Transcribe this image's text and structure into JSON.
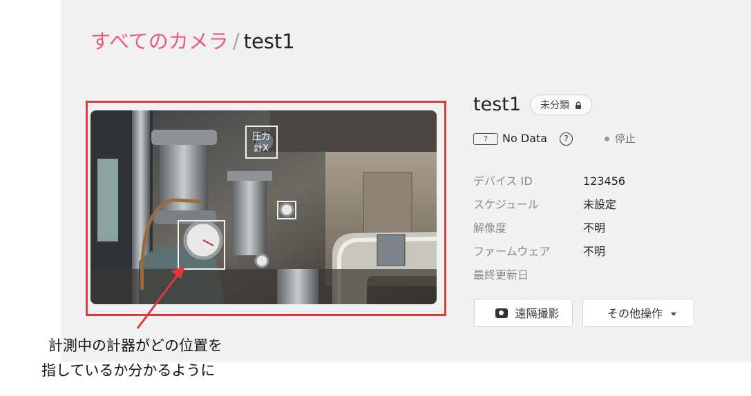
{
  "breadcrumb": {
    "root_label": "すべてのカメラ",
    "separator": "/",
    "current_label": "test1"
  },
  "camera": {
    "overlay_label_line1": "圧力",
    "overlay_label_line2": "計X"
  },
  "device": {
    "title": "test1",
    "badge_label": "未分類",
    "badge_icon": "lock-icon",
    "data_box_label": "?",
    "data_status": "No Data",
    "help_icon": "question-circle-icon",
    "run_state": "停止"
  },
  "info": [
    {
      "key": "デバイス ID",
      "value": "123456"
    },
    {
      "key": "スケジュール",
      "value": "未設定"
    },
    {
      "key": "解像度",
      "value": "不明"
    },
    {
      "key": "ファームウェア",
      "value": "不明"
    },
    {
      "key": "最終更新日",
      "value": ""
    }
  ],
  "actions": {
    "remote_capture_label": "遠隔撮影",
    "remote_capture_icon": "camera-icon",
    "more_actions_label": "その他操作",
    "more_actions_icon": "caret-down-icon"
  },
  "annotation": {
    "line1": "計測中の計器がどの位置を",
    "line2": "指しているか分かるように"
  },
  "colors": {
    "accent": "#ec5b7a",
    "highlight": "#e2373d",
    "panel_bg": "#f1f1f1"
  }
}
